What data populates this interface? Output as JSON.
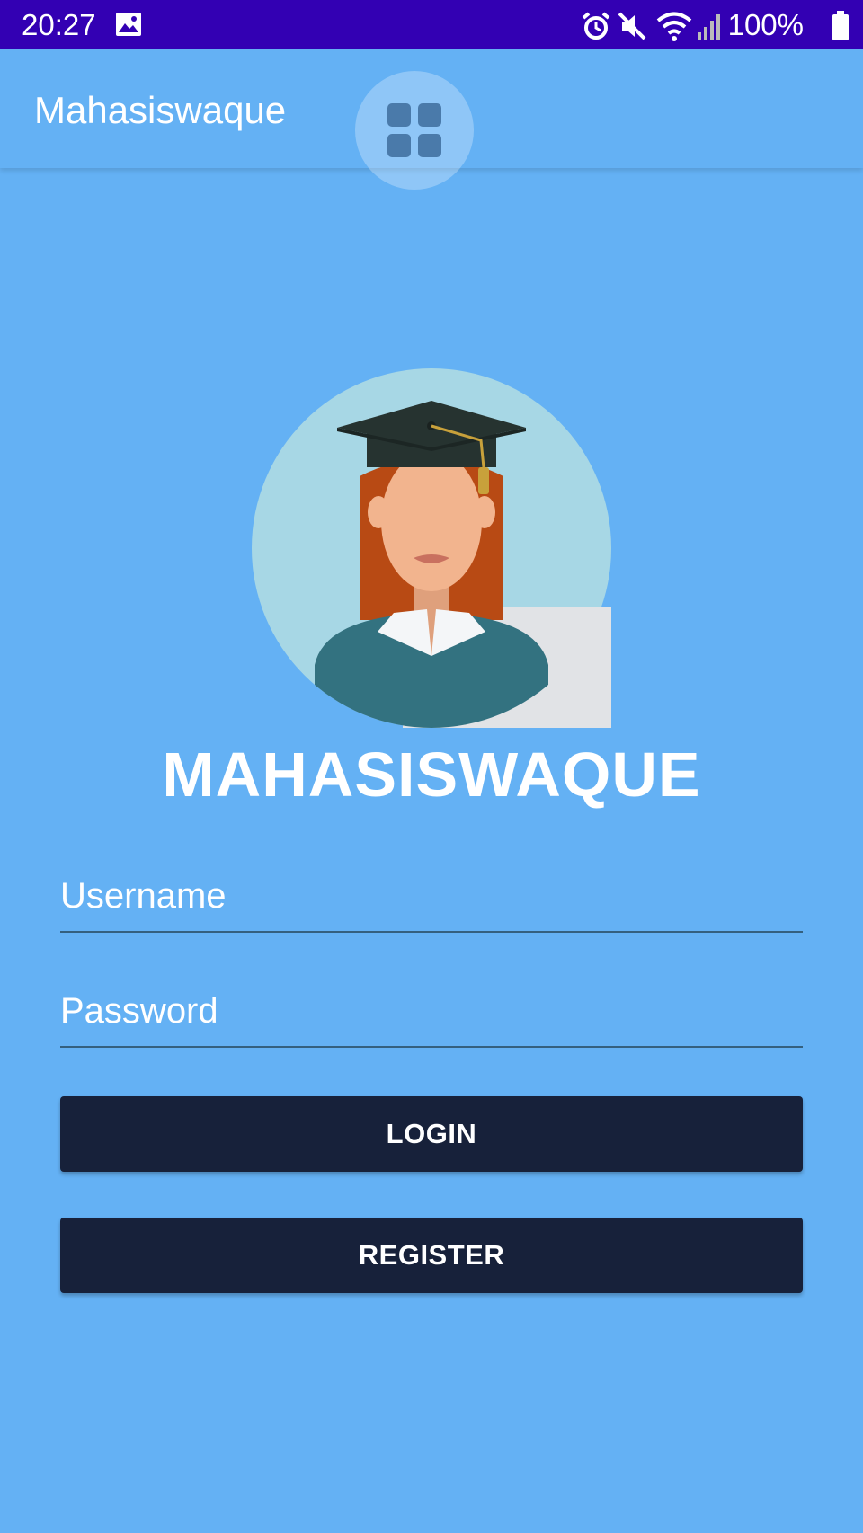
{
  "status_bar": {
    "time": "20:27",
    "battery": "100%",
    "icons": [
      "image-icon",
      "alarm-icon",
      "mute-icon",
      "wifi-icon",
      "signal-icon",
      "battery-icon"
    ]
  },
  "app_bar": {
    "title": "Mahasiswaque",
    "floating_icon": "grid-icon"
  },
  "illustration": {
    "icon": "graduate-avatar-icon"
  },
  "brand": {
    "title": "MAHASISWAQUE"
  },
  "form": {
    "username_placeholder": "Username",
    "password_placeholder": "Password",
    "username_value": "",
    "password_value": ""
  },
  "buttons": {
    "login": "LOGIN",
    "register": "REGISTER"
  },
  "colors": {
    "status_bar": "#3300B3",
    "background": "#64B1F4",
    "button": "#17213A"
  }
}
